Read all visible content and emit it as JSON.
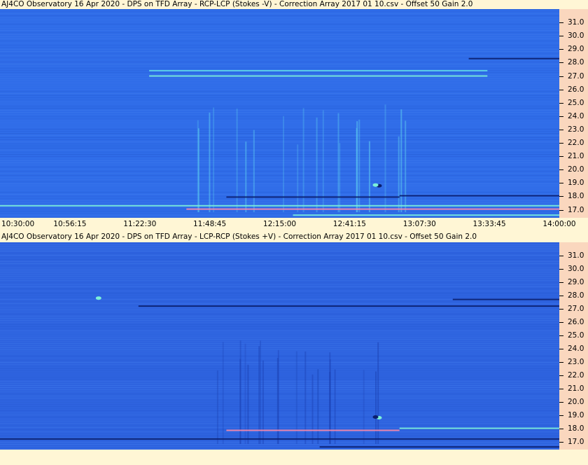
{
  "chart_data": [
    {
      "type": "heatmap",
      "title": "AJ4CO Observatory 16 Apr 2020  -  DPS on TFD Array  -  RCP-LCP (Stokes -V)  -  Correction Array 2017 01 10.csv  -  Offset 50  Gain 2.0",
      "x_tick_labels": [
        "10:30:00",
        "10:56:15",
        "11:22:30",
        "11:48:45",
        "12:15:00",
        "12:41:15",
        "13:07:30",
        "13:33:45",
        "14:00:00"
      ],
      "y_tick_values": [
        17.0,
        18.0,
        19.0,
        20.0,
        21.0,
        22.0,
        23.0,
        24.0,
        25.0,
        26.0,
        27.0,
        28.0,
        29.0,
        30.0,
        31.0
      ],
      "ylim": [
        16.4,
        32.0
      ],
      "colors": {
        "background": "#2F6CE8",
        "bright": "#7CF0D8",
        "dark": "#0A1E6E"
      },
      "features": [
        {
          "kind": "band",
          "from": "11:26:00",
          "to": "13:33:00",
          "freq": 27.0,
          "color": "#7CF0D8"
        },
        {
          "kind": "band",
          "from": "11:26:00",
          "to": "13:33:00",
          "freq": 27.4,
          "color": "#5FD8E8"
        },
        {
          "kind": "band",
          "from": "13:26:00",
          "to": "14:00:00",
          "freq": 28.3,
          "color": "#0A1E6E"
        },
        {
          "kind": "band",
          "from": "10:30:00",
          "to": "14:00:00",
          "freq": 17.3,
          "color": "#7CF0D8"
        },
        {
          "kind": "band",
          "from": "11:55:00",
          "to": "13:00:00",
          "freq": 17.95,
          "color": "#0A1E6E"
        },
        {
          "kind": "band",
          "from": "13:00:00",
          "to": "14:00:00",
          "freq": 18.05,
          "color": "#0A1E6E"
        },
        {
          "kind": "band",
          "from": "11:40:00",
          "to": "14:00:00",
          "freq": 17.05,
          "color": "#FF8AA8"
        },
        {
          "kind": "band",
          "from": "12:20:00",
          "to": "14:00:00",
          "freq": 16.6,
          "color": "#7CF0D8"
        },
        {
          "kind": "spot",
          "time": "12:52:20",
          "freq": 18.8,
          "color": "#0A1E6E"
        },
        {
          "kind": "spot",
          "time": "12:51:00",
          "freq": 18.85,
          "color": "#7CF0D8"
        }
      ]
    },
    {
      "type": "heatmap",
      "title": "AJ4CO Observatory 16 Apr 2020  -  DPS on TFD Array  -  LCP-RCP (Stokes +V)  -  Correction Array 2017 01 10.csv  -  Offset 50  Gain 2.0",
      "x_tick_labels": [],
      "y_tick_values": [
        17.0,
        18.0,
        19.0,
        20.0,
        21.0,
        22.0,
        23.0,
        24.0,
        25.0,
        26.0,
        27.0,
        28.0,
        29.0,
        30.0,
        31.0
      ],
      "ylim": [
        16.4,
        32.0
      ],
      "colors": {
        "background": "#2E63DF",
        "bright": "#7CF0D8",
        "dark": "#0A1E6E"
      },
      "features": [
        {
          "kind": "band",
          "from": "11:22:00",
          "to": "14:00:00",
          "freq": 27.2,
          "color": "#0A1E6E"
        },
        {
          "kind": "band",
          "from": "13:20:00",
          "to": "14:00:00",
          "freq": 27.7,
          "color": "#0A1E6E"
        },
        {
          "kind": "band",
          "from": "10:30:00",
          "to": "14:00:00",
          "freq": 17.2,
          "color": "#0A1E6E"
        },
        {
          "kind": "band",
          "from": "11:55:00",
          "to": "13:00:00",
          "freq": 17.85,
          "color": "#FF8AA8"
        },
        {
          "kind": "band",
          "from": "13:00:00",
          "to": "14:00:00",
          "freq": 18.0,
          "color": "#7CF0D8"
        },
        {
          "kind": "band",
          "from": "12:30:00",
          "to": "14:00:00",
          "freq": 16.6,
          "color": "#0A1E6E"
        },
        {
          "kind": "spot",
          "time": "12:52:20",
          "freq": 18.8,
          "color": "#7CF0D8"
        },
        {
          "kind": "spot",
          "time": "12:51:00",
          "freq": 18.85,
          "color": "#0A1E6E"
        },
        {
          "kind": "spot",
          "time": "11:07:00",
          "freq": 27.8,
          "color": "#7CF0D8"
        }
      ]
    }
  ]
}
